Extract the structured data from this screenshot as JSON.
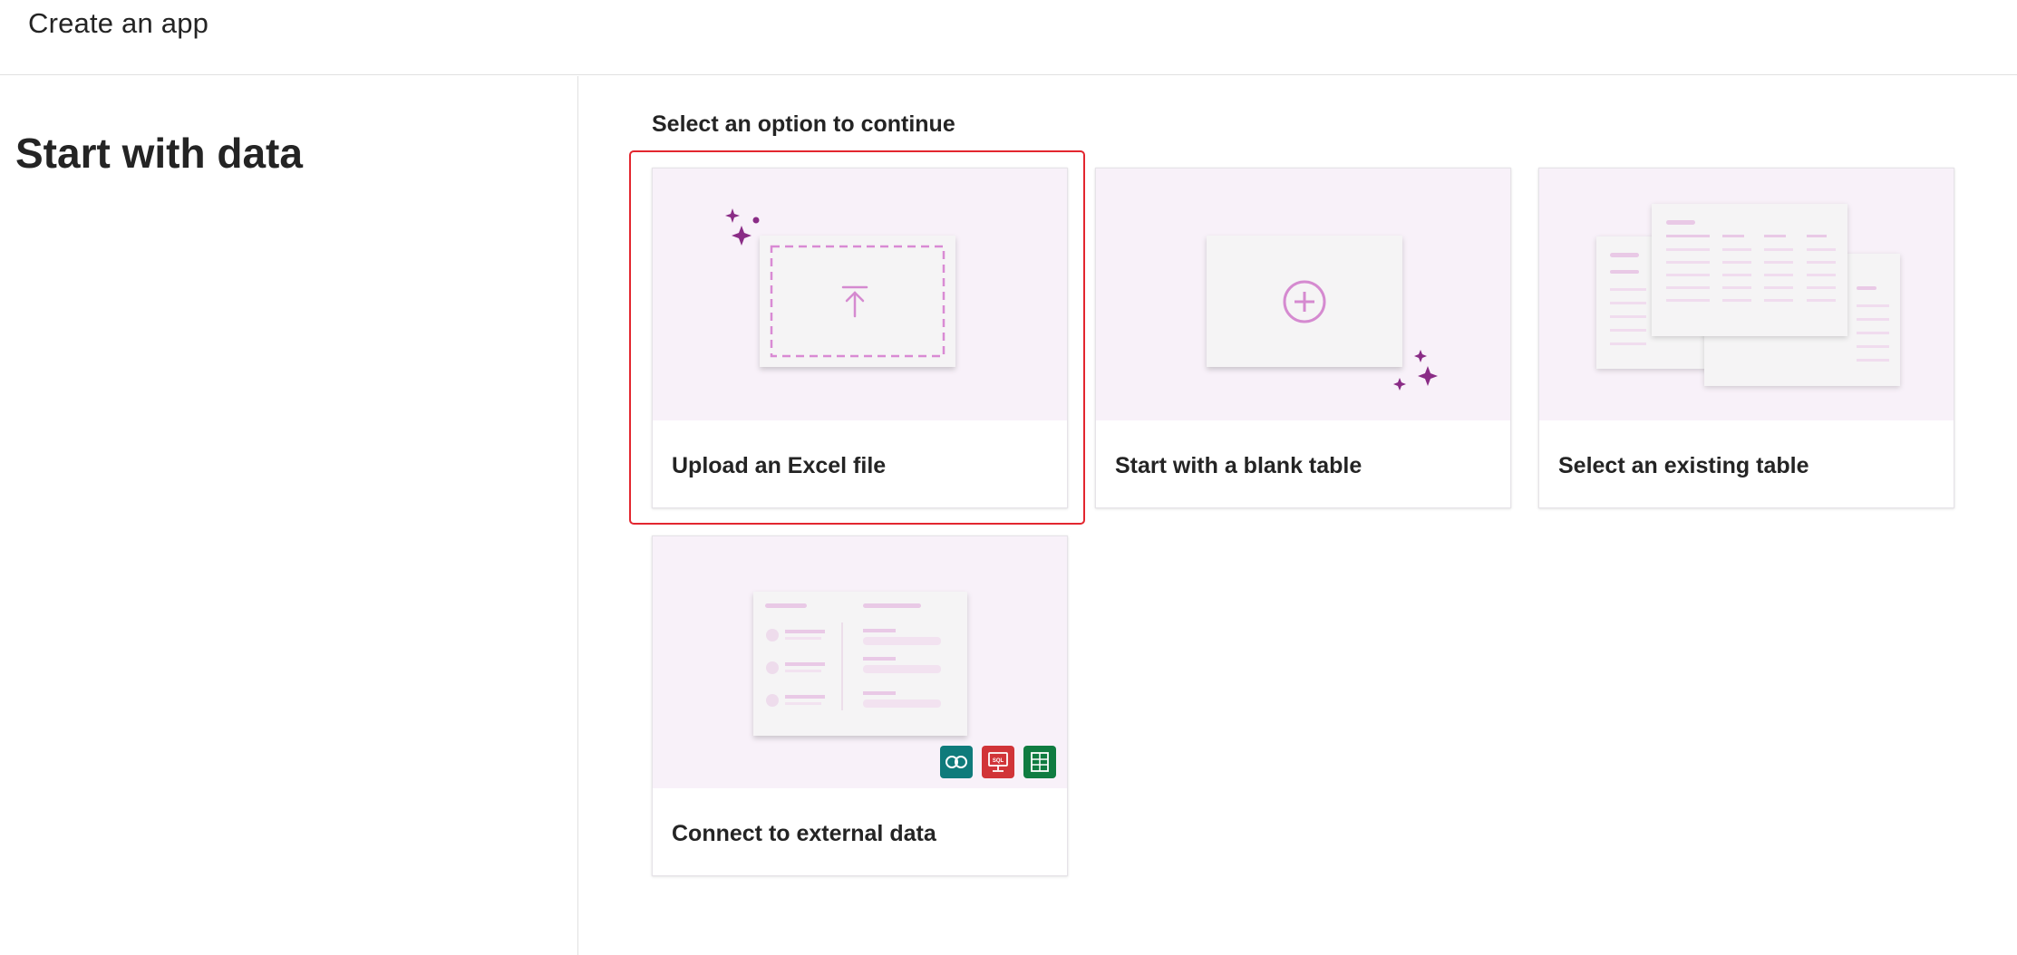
{
  "header": {
    "title": "Create an app"
  },
  "left": {
    "section_title": "Start with data"
  },
  "main": {
    "prompt": "Select an option to continue",
    "cards": [
      {
        "label": "Upload an Excel file",
        "selected": true
      },
      {
        "label": "Start with a blank table",
        "selected": false
      },
      {
        "label": "Select an existing table",
        "selected": false
      },
      {
        "label": "Connect to external data",
        "selected": false
      }
    ]
  },
  "connector_icons": [
    {
      "name": "dataverse-icon",
      "color": "#0f7b7b"
    },
    {
      "name": "sql-icon",
      "color": "#d13438",
      "text": "SQL"
    },
    {
      "name": "excel-icon",
      "color": "#107c41"
    }
  ],
  "colors": {
    "accent": "#8a2c86",
    "illustration_bg": "#f8f1f9",
    "selection_outline": "#e3262f",
    "dashed": "#d98ad4"
  }
}
